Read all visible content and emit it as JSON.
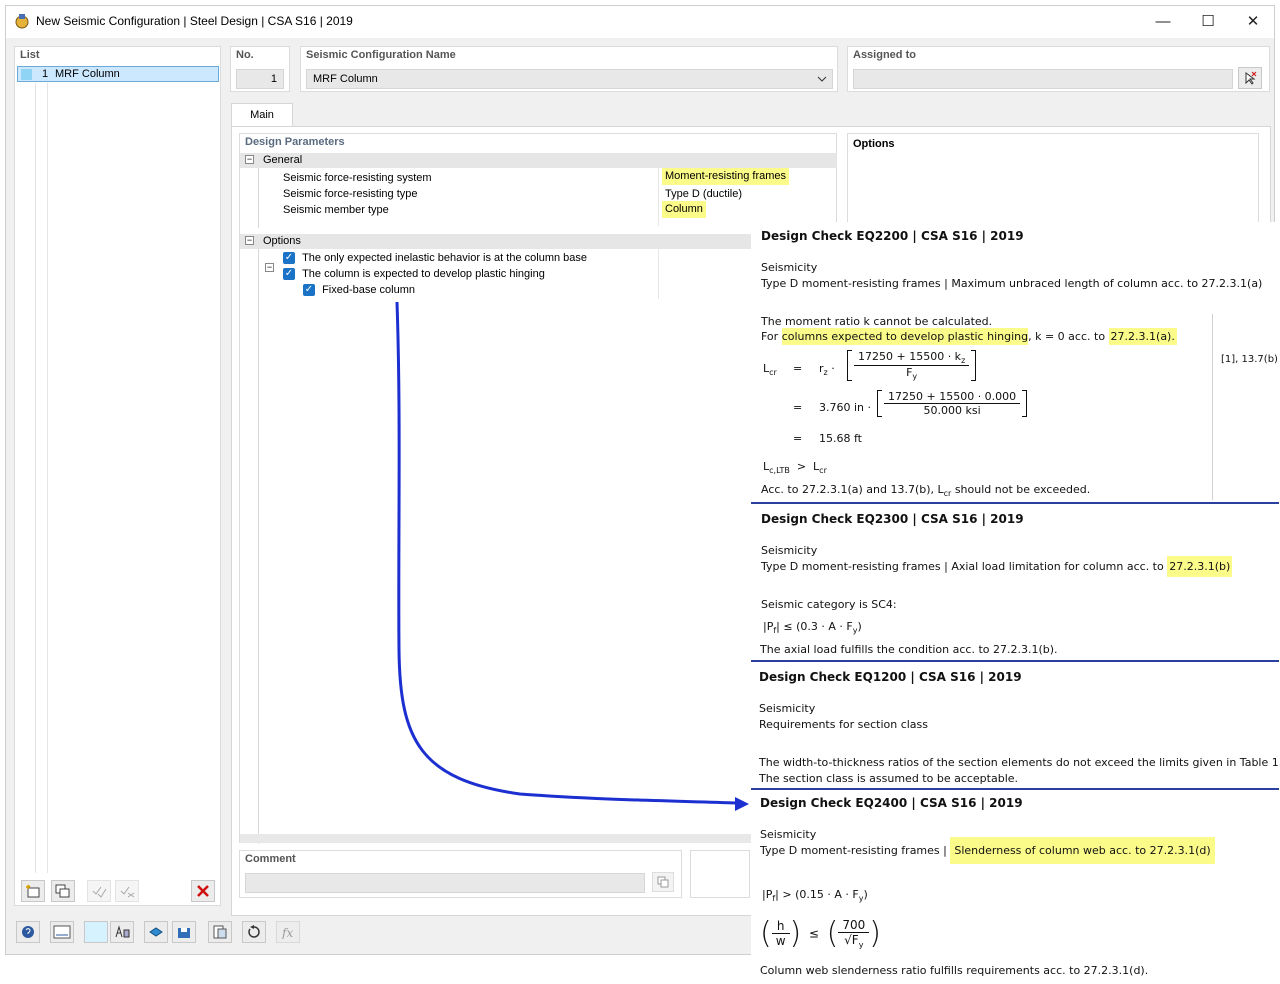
{
  "window": {
    "title": "New Seismic Configuration | Steel Design | CSA S16 | 2019",
    "minimize": "—",
    "maximize": "☐",
    "close": "✕"
  },
  "list": {
    "header": "List",
    "items": [
      {
        "no": "1",
        "name": "MRF Column"
      }
    ]
  },
  "header": {
    "no_label": "No.",
    "no_value": "1",
    "name_label": "Seismic Configuration Name",
    "name_value": "MRF Column",
    "assigned_label": "Assigned to",
    "assigned_value": ""
  },
  "tabs": [
    {
      "label": "Main"
    }
  ],
  "design_params": {
    "title": "Design Parameters",
    "general_label": "General",
    "rows": [
      {
        "label": "Seismic force-resisting system",
        "value": "Moment-resisting frames"
      },
      {
        "label": "Seismic force-resisting type",
        "value": "Type D (ductile)"
      },
      {
        "label": "Seismic member type",
        "value": "Column"
      }
    ],
    "options_label": "Options",
    "options": [
      {
        "label": "The only expected inelastic behavior is at the column base"
      },
      {
        "label": "The column is expected to develop plastic hinging"
      },
      {
        "label": "Fixed-base column"
      }
    ]
  },
  "options_panel": {
    "title": "Options"
  },
  "comment": {
    "label": "Comment",
    "value": ""
  },
  "report": {
    "eq2200": {
      "title": "Design Check EQ2200 | CSA S16 | 2019",
      "category": "Seismicity",
      "desc": "Type D moment-resisting frames | Maximum unbraced length of column acc. to 27.2.3.1(a)",
      "note1": "The moment ratio k cannot be calculated.",
      "note2_pre": "For ",
      "note2_hl": "columns expected to develop plastic hinging",
      "note2_mid": ", k = 0 acc. to ",
      "note2_ref": "27.2.3.1(a).",
      "ref": "[1], 13.7(b)",
      "lcr": "L",
      "lcr_sub": "cr",
      "eq": "=",
      "rz": "r",
      "rz_sub": "z",
      "num1": "17250 + 15500 · k",
      "num1_sub": "z",
      "den1": "F",
      "den1_sub": "y",
      "val_rz": "3.760 in",
      "num2": "17250 + 15500 · 0.000",
      "den2": "50.000 ksi",
      "result": "15.68 ft",
      "cmp_lhs": "L",
      "cmp_lhs_sub": "c,LTB",
      "cmp_op": ">",
      "cmp_rhs": "L",
      "cmp_rhs_sub": "cr",
      "conclusion_pre": "Acc. to 27.2.3.1(a) and 13.7(b), L",
      "conclusion_sub": "cr",
      "conclusion_post": " should not be exceeded."
    },
    "eq2300": {
      "title": "Design Check EQ2300 | CSA S16 | 2019",
      "category": "Seismicity",
      "desc_pre": "Type D moment-resisting frames | Axial load limitation for column acc. to ",
      "desc_hl": "27.2.3.1(b)",
      "seis_cat": "Seismic category is SC4:",
      "formula": "|P",
      "formula_sub": "f",
      "formula_post": "|  ≤  (0.3 · A · F",
      "formula_sub2": "y",
      "formula_end": ")",
      "conclusion": "The axial load fulfills the condition acc. to 27.2.3.1(b)."
    },
    "eq1200": {
      "title": "Design Check EQ1200 | CSA S16 | 2019",
      "category": "Seismicity",
      "desc": "Requirements for section class",
      "line1": "The width-to-thickness ratios of the section elements do not exceed the limits given in Table 1.",
      "line2": "The section class is assumed to be acceptable."
    },
    "eq2400": {
      "title": "Design Check EQ2400 | CSA S16 | 2019",
      "category": "Seismicity",
      "desc_pre": "Type D moment-resisting frames | ",
      "desc_hl": "Slenderness of column web acc. to 27.2.3.1(d)",
      "formula": "|P",
      "formula_sub": "f",
      "formula_post": "|  >  (0.15 · A · F",
      "formula_sub2": "y",
      "formula_end": ")",
      "h": "h",
      "w": "w",
      "le": "≤",
      "n700": "700",
      "fy": "F",
      "fy_sub": "y",
      "conclusion": "Column web slenderness ratio fulfills requirements acc. to 27.2.3.1(d)."
    }
  },
  "colors": {
    "highlight": "#fbfb8a",
    "arrow": "#1c2fd0",
    "separator": "#2b3f9e",
    "check": "#1a73c7"
  }
}
